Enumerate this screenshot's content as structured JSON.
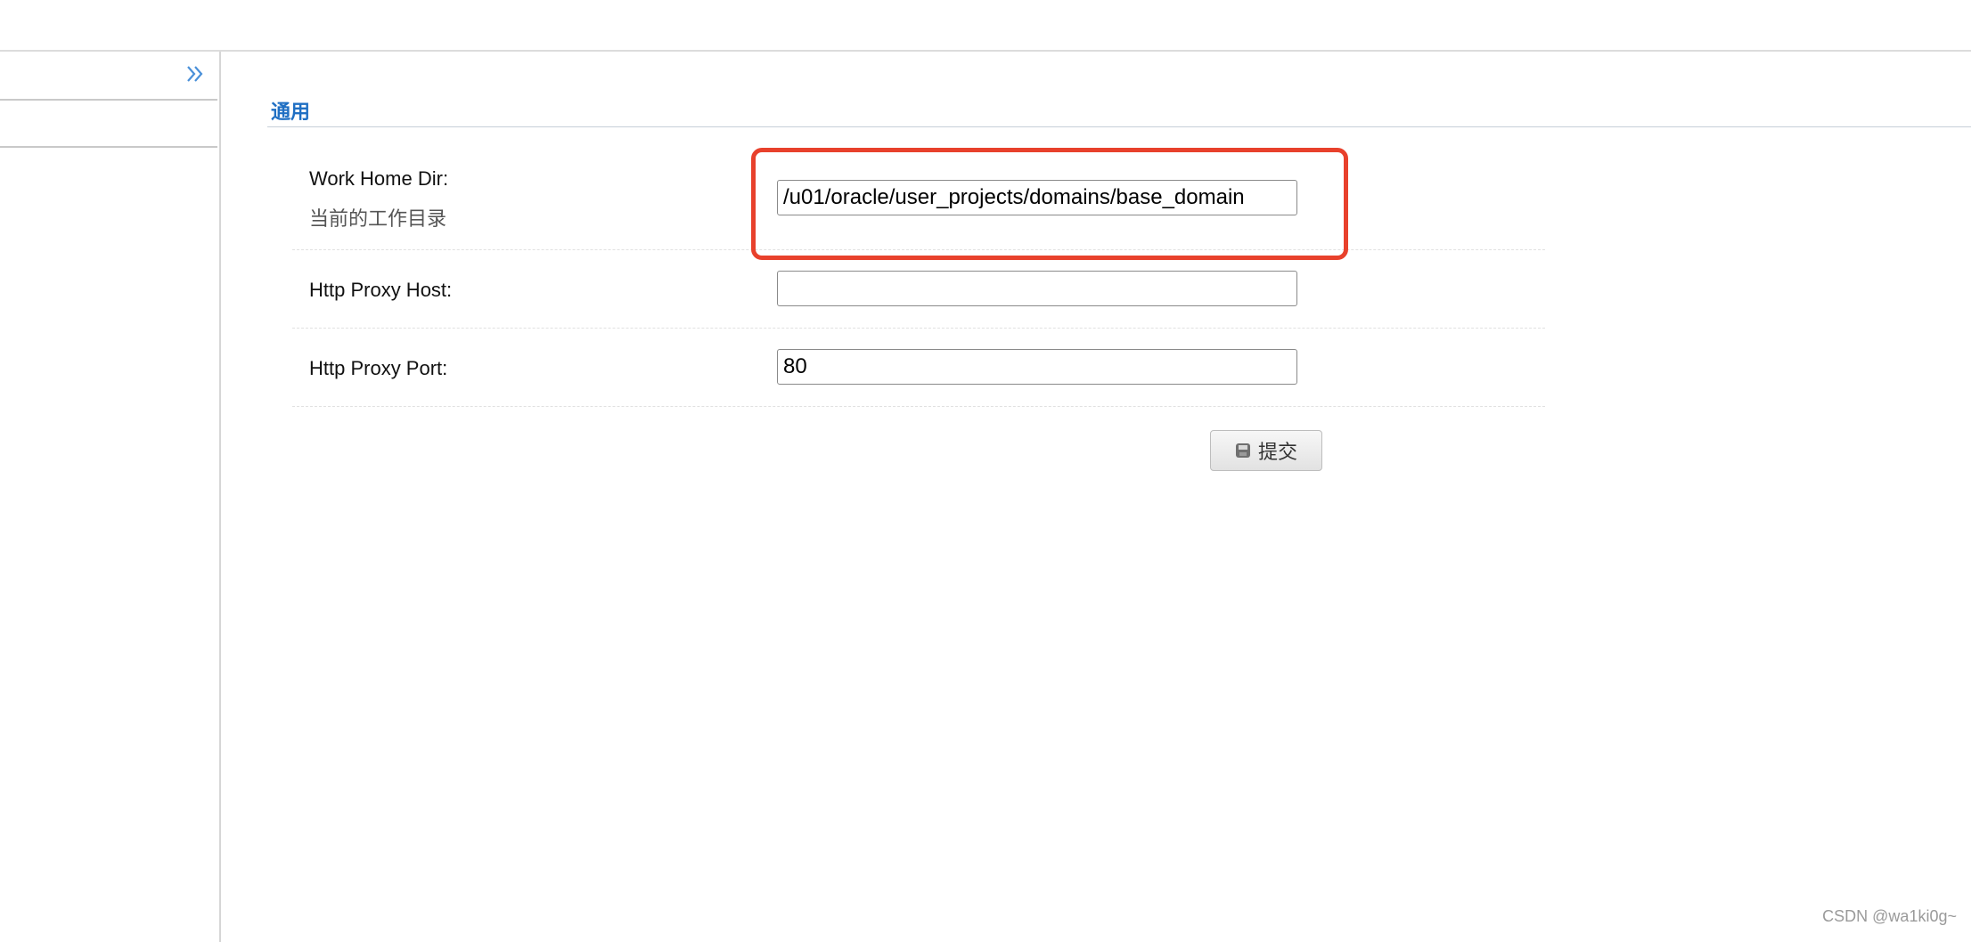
{
  "sidebar": {
    "collapse_icon": "double-chevron-right-icon"
  },
  "section": {
    "title": "通用"
  },
  "form": {
    "work_home_dir": {
      "label": "Work Home Dir:",
      "description": "当前的工作目录",
      "value": "/u01/oracle/user_projects/domains/base_domain"
    },
    "http_proxy_host": {
      "label": "Http Proxy Host:",
      "value": ""
    },
    "http_proxy_port": {
      "label": "Http Proxy Port:",
      "value": "80"
    },
    "submit": {
      "label": "提交",
      "icon": "save-icon"
    }
  },
  "annotation": {
    "highlight_color": "#e8412c"
  },
  "watermark": "CSDN @wa1ki0g~",
  "colors": {
    "section_title": "#1f6fc3",
    "accent_icon": "#4a90d9"
  }
}
